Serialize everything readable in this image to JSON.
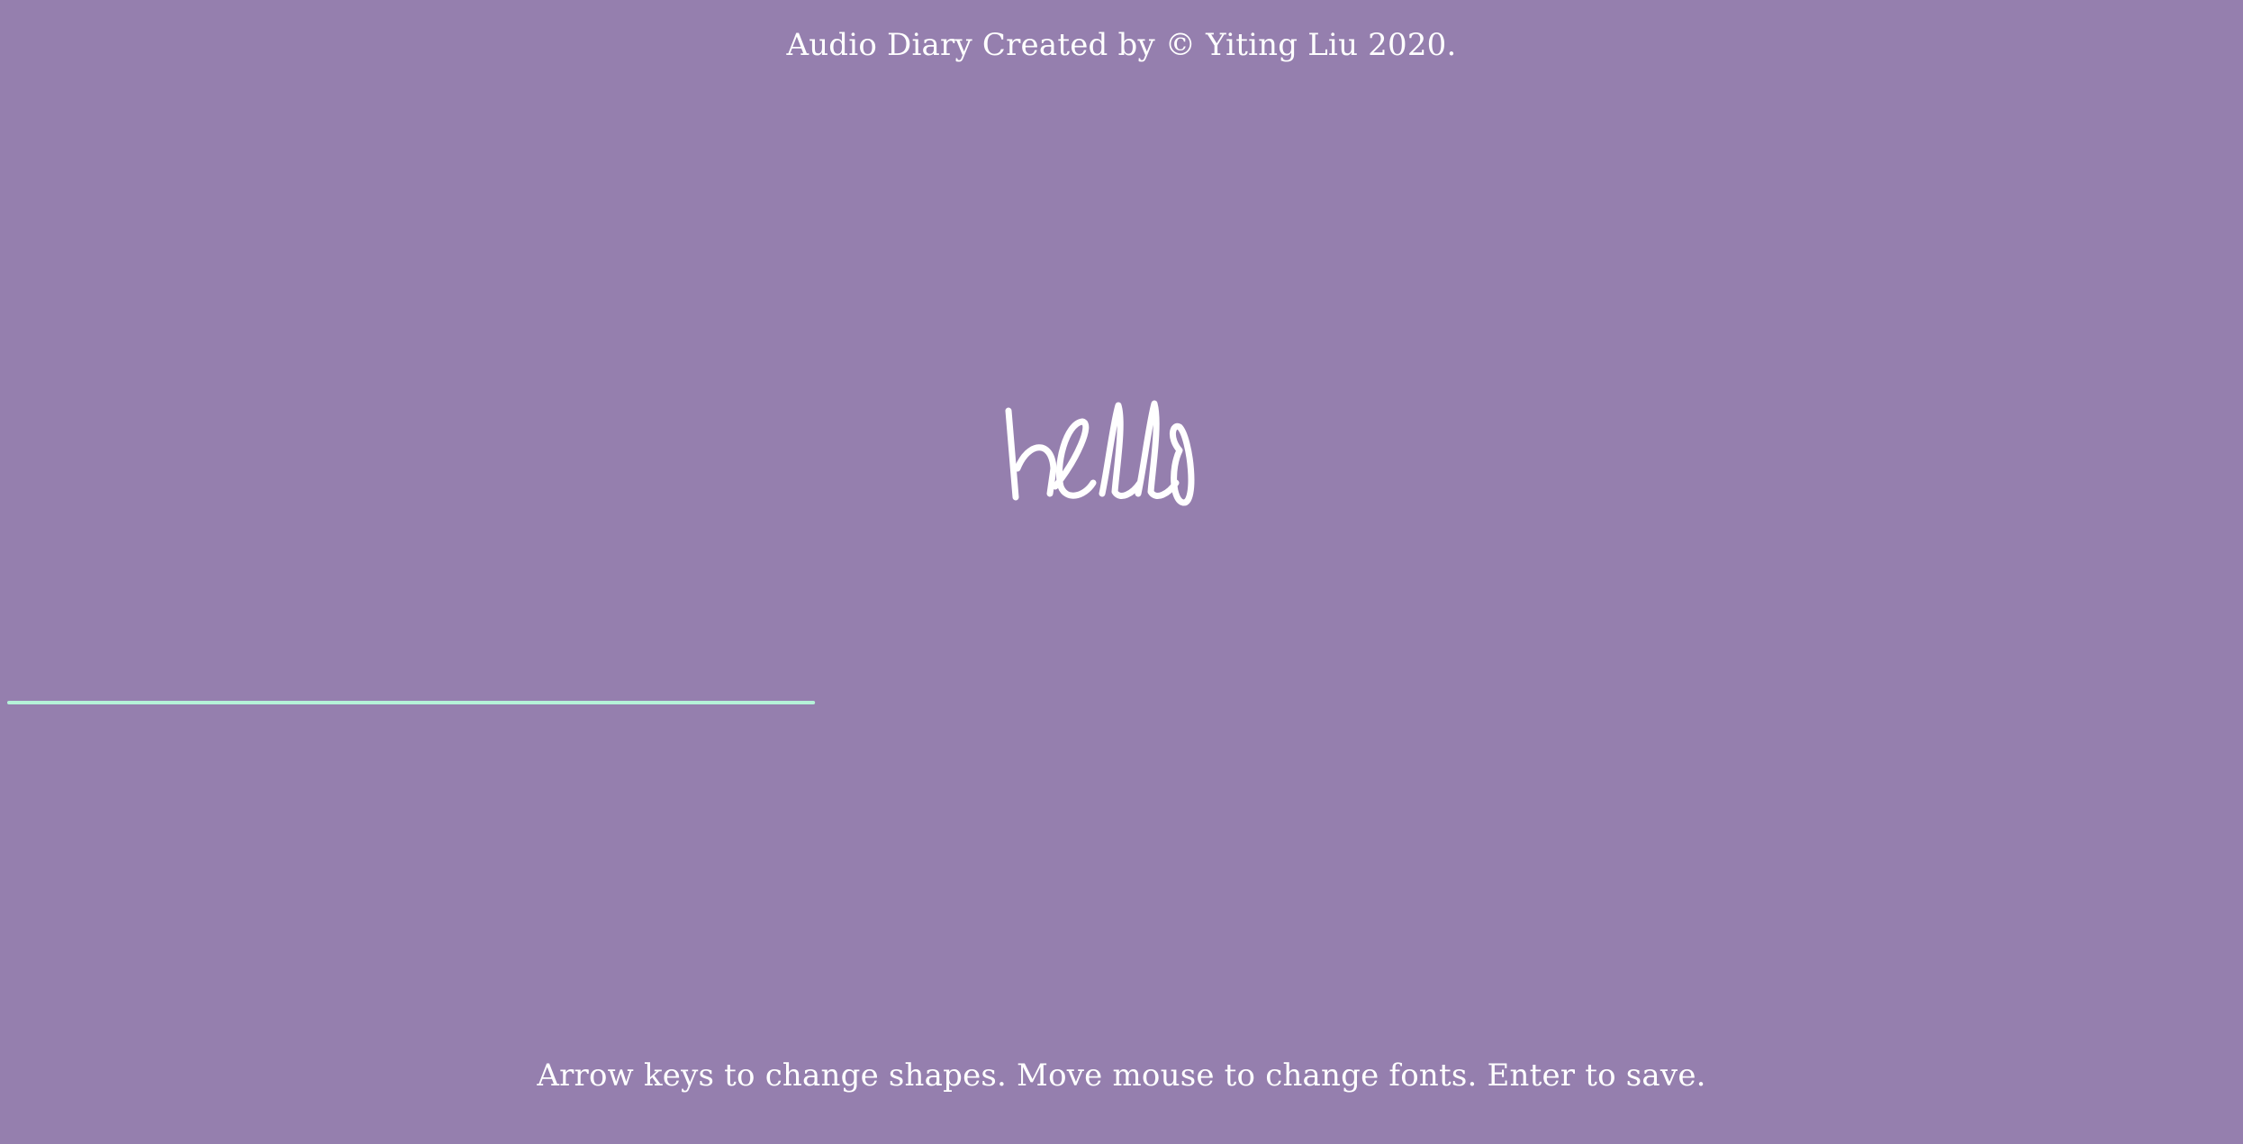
{
  "header": {
    "credit_text": "Audio Diary Created by © Yiting Liu 2020."
  },
  "canvas": {
    "word": "hello",
    "word_color": "#ffffff",
    "background_color": "#957fae",
    "audio_level_color": "#b5f2d8",
    "audio_level_fraction": 0.36
  },
  "footer": {
    "instructions_text": "Arrow keys to change shapes. Move mouse to change fonts. Enter to save."
  }
}
